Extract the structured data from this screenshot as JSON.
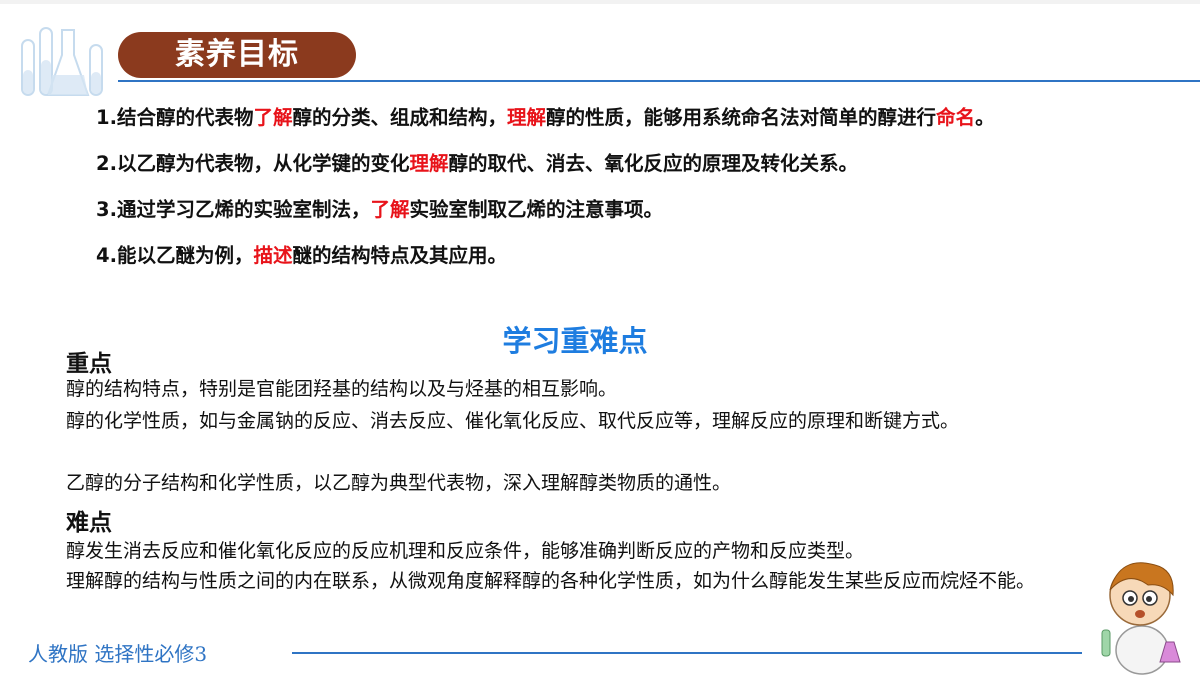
{
  "header": {
    "badge": "素养目标"
  },
  "objectives": [
    {
      "segments": [
        {
          "text": "1.结合醇的代表物",
          "hl": false
        },
        {
          "text": "了解",
          "hl": true
        },
        {
          "text": "醇的分类、组成和结构，",
          "hl": false
        },
        {
          "text": "理解",
          "hl": true
        },
        {
          "text": "醇的性质，能够用系统命名法对简单的醇进行",
          "hl": false
        },
        {
          "text": "命名",
          "hl": true
        },
        {
          "text": "。",
          "hl": false
        }
      ]
    },
    {
      "segments": [
        {
          "text": "2.以乙醇为代表物，从化学键的变化",
          "hl": false
        },
        {
          "text": "理解",
          "hl": true
        },
        {
          "text": "醇的取代、消去、氧化反应的原理及转化关系。",
          "hl": false
        }
      ]
    },
    {
      "segments": [
        {
          "text": "3.通过学习乙烯的实验室制法，",
          "hl": false
        },
        {
          "text": "了解",
          "hl": true
        },
        {
          "text": "实验室制取乙烯的注意事项。",
          "hl": false
        }
      ]
    },
    {
      "segments": [
        {
          "text": "4.能以乙醚为例，",
          "hl": false
        },
        {
          "text": "描述",
          "hl": true
        },
        {
          "text": "醚的结构特点及其应用。",
          "hl": false
        }
      ]
    }
  ],
  "difficulties": {
    "title": "学习重难点",
    "key_heading": "重点",
    "key_points": [
      "醇的结构特点，特别是官能团羟基的结构以及与烃基的相互影响。",
      "醇的化学性质，如与金属钠的反应、消去反应、催化氧化反应、取代反应等，理解反应的原理和断键方式。",
      "乙醇的分子结构和化学性质，以乙醇为典型代表物，深入理解醇类物质的通性。"
    ],
    "hard_heading": "难点",
    "hard_points": [
      "醇发生消去反应和催化氧化反应的反应机理和反应条件，能够准确判断反应的产物和反应类型。",
      "理解醇的结构与性质之间的内在联系，从微观角度解释醇的各种化学性质，如为什么醇能发生某些反应而烷烃不能。"
    ]
  },
  "footer": {
    "text": "人教版 选择性必修3"
  },
  "colors": {
    "badge": "#8b3a1e",
    "accent_blue": "#2f74c4",
    "highlight_red": "#e8131a",
    "title_blue": "#1e7de0"
  },
  "icons": {
    "top_left": "lab-glassware-icon",
    "bottom_right": "scientist-mascot-icon"
  }
}
